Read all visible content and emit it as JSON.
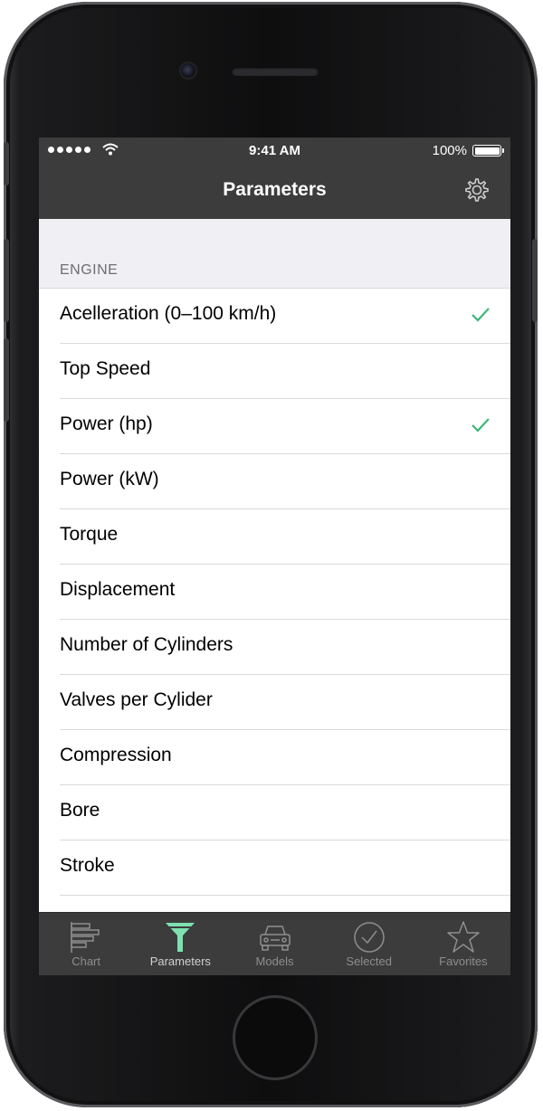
{
  "status_bar": {
    "time": "9:41 AM",
    "battery_percent": "100%"
  },
  "nav": {
    "title": "Parameters",
    "settings_icon": "gear-icon"
  },
  "section": {
    "title": "ENGINE"
  },
  "rows": [
    {
      "label": "Acelleration (0–100 km/h)",
      "checked": true
    },
    {
      "label": "Top Speed",
      "checked": false
    },
    {
      "label": "Power (hp)",
      "checked": true
    },
    {
      "label": "Power (kW)",
      "checked": false
    },
    {
      "label": "Torque",
      "checked": false
    },
    {
      "label": "Displacement",
      "checked": false
    },
    {
      "label": "Number of Cylinders",
      "checked": false
    },
    {
      "label": "Valves per Cylider",
      "checked": false
    },
    {
      "label": "Compression",
      "checked": false
    },
    {
      "label": "Bore",
      "checked": false
    },
    {
      "label": "Stroke",
      "checked": false
    }
  ],
  "tabs": [
    {
      "label": "Chart",
      "icon": "bar-chart-icon",
      "active": false
    },
    {
      "label": "Parameters",
      "icon": "filter-icon",
      "active": true
    },
    {
      "label": "Models",
      "icon": "car-icon",
      "active": false
    },
    {
      "label": "Selected",
      "icon": "checkmark-circle-icon",
      "active": false
    },
    {
      "label": "Favorites",
      "icon": "star-icon",
      "active": false
    }
  ],
  "colors": {
    "bar_background": "#3c3c3c",
    "accent_green": "#3cb878",
    "active_tab_icon": "#7ee0b0",
    "section_background": "#efeff4"
  }
}
